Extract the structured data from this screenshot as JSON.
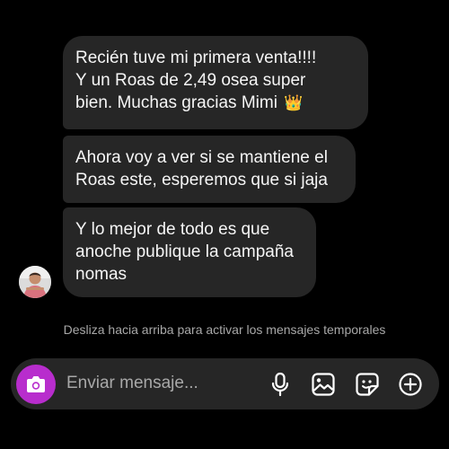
{
  "messages": [
    {
      "lines": [
        "Recién tuve mi primera venta!!!!",
        "Y un Roas de 2,49 osea super",
        "bien. Muchas gracias Mimi"
      ],
      "emoji": "👑"
    },
    {
      "lines": [
        "Ahora voy a ver si se mantiene el",
        "Roas este, esperemos que si jaja"
      ]
    },
    {
      "lines": [
        "Y lo mejor de todo es que",
        "anoche publique la campaña",
        "nomas"
      ]
    }
  ],
  "notice": "Desliza hacia arriba para activar los mensajes temporales",
  "composer": {
    "placeholder": "Enviar mensaje...",
    "icons": [
      "camera-icon",
      "microphone-icon",
      "gallery-icon",
      "sticker-icon",
      "plus-icon"
    ],
    "camera_color": "#b82dcd"
  },
  "colors": {
    "background": "#000000",
    "bubble": "#262626",
    "text": "#f5f5f5",
    "muted": "#a8a8a8"
  }
}
